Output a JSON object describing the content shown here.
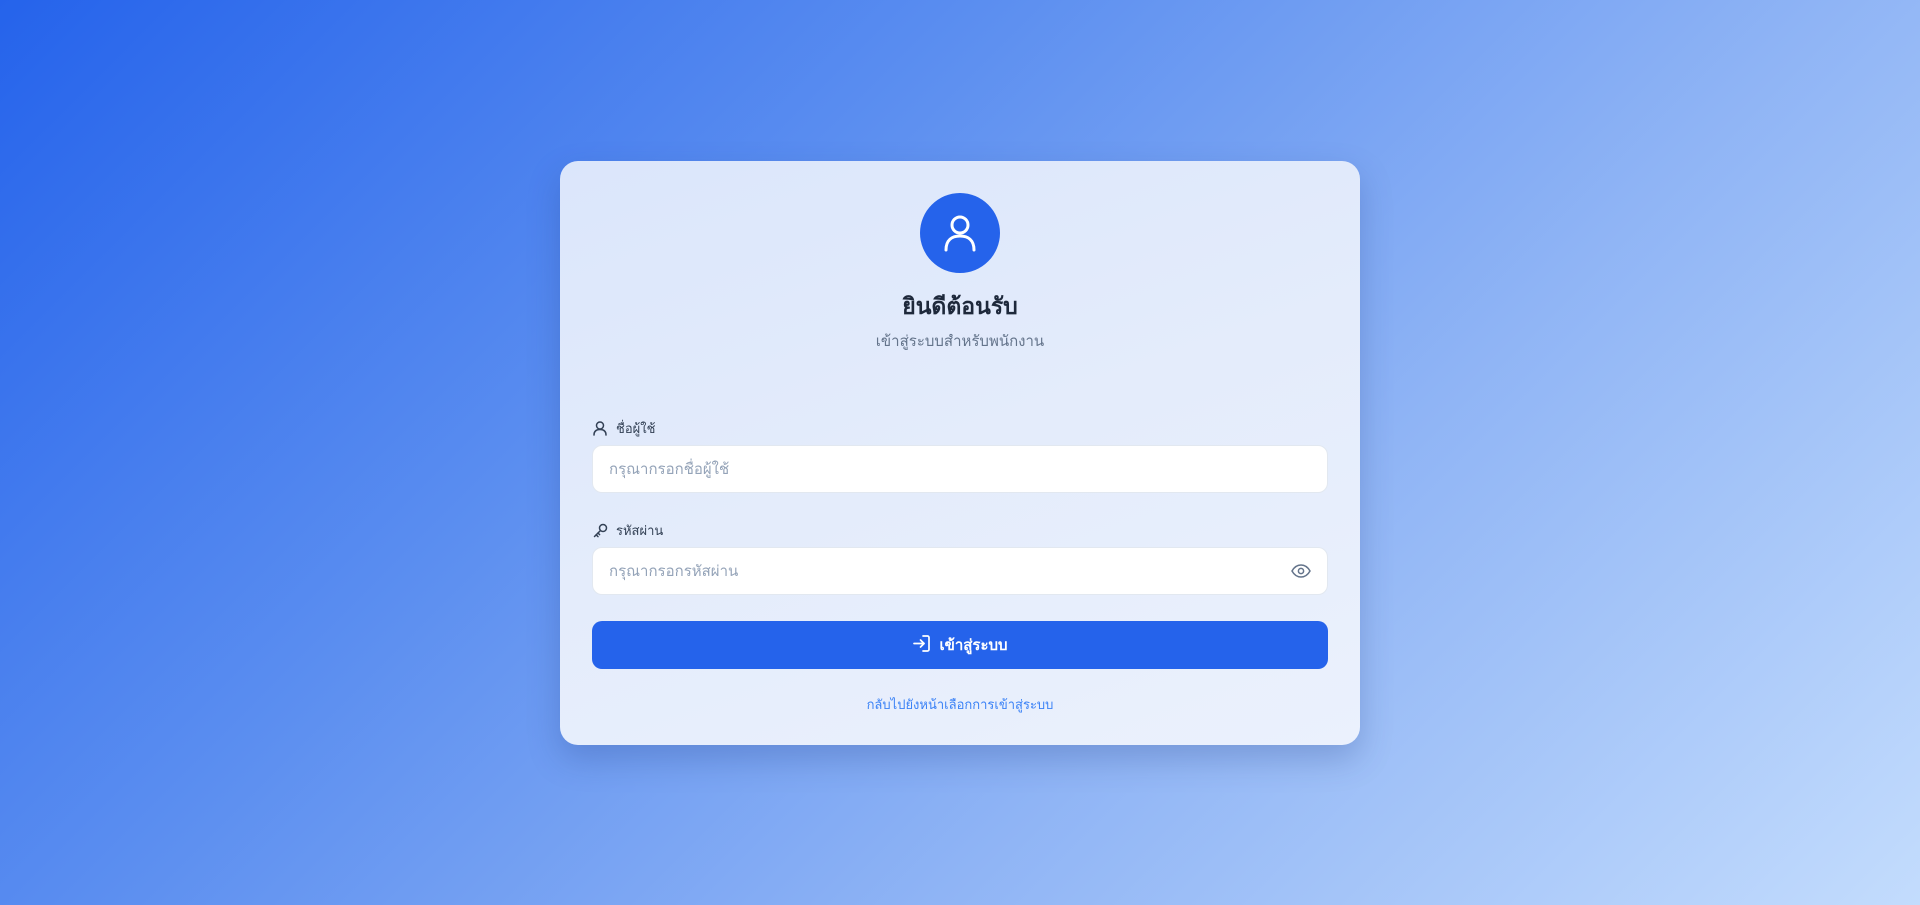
{
  "header": {
    "title": "ยินดีต้อนรับ",
    "subtitle": "เข้าสู่ระบบสำหรับพนักงาน",
    "avatar_icon": "user-icon"
  },
  "form": {
    "username": {
      "label": "ชื่อผู้ใช้",
      "icon": "user-icon",
      "value": "",
      "placeholder": "กรุณากรอกชื่อผู้ใช้"
    },
    "password": {
      "label": "รหัสผ่าน",
      "icon": "key-icon",
      "value": "",
      "placeholder": "กรุณากรอกรหัสผ่าน",
      "toggle_icon": "eye-icon"
    },
    "submit": {
      "label": "เข้าสู่ระบบ",
      "icon": "login-icon"
    },
    "back_link": "กลับไปยังหน้าเลือกการเข้าสู่ระบบ"
  },
  "colors": {
    "primary": "#2563eb",
    "link": "#3b82f6",
    "title": "#1e293b",
    "muted": "#64748b"
  }
}
